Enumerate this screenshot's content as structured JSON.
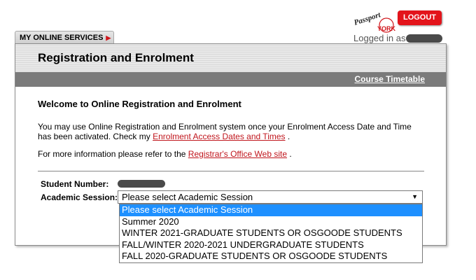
{
  "branding": {
    "logo_top": "Passport",
    "logo_bottom": "YORK",
    "logout_label": "LOGOUT",
    "logged_in_label": "Logged in as"
  },
  "nav": {
    "services_tab": "MY ONLINE SERVICES",
    "services_arrow": "▶"
  },
  "panel": {
    "title": "Registration and Enrolment",
    "timetable_link": "Course Timetable"
  },
  "content": {
    "welcome": "Welcome to Online Registration and Enrolment",
    "para1_text": "You may use Online Registration and Enrolment system once your Enrolment Access Date and Time has been activated. Check my",
    "para1_link": "Enrolment Access Dates and Times",
    "para1_end": ".",
    "para2_text": "For more information please refer to the",
    "para2_link": "Registrar's Office Web site",
    "para2_end": "."
  },
  "form": {
    "student_number_label": "Student Number:",
    "session_label": "Academic Session:",
    "session_selected": "Please select Academic Session",
    "session_options": [
      "Please select Academic Session",
      "Summer 2020",
      "WINTER 2021-GRADUATE STUDENTS OR OSGOODE STUDENTS",
      "FALL/WINTER 2020-2021 UNDERGRADUATE STUDENTS",
      "FALL 2020-GRADUATE STUDENTS OR OSGOODE STUDENTS"
    ]
  },
  "colors": {
    "accent_red": "#e3141b",
    "link_red": "#c0151c",
    "highlight_blue": "#1e90ff",
    "bar_gray": "#7b7b7b"
  },
  "icons": {
    "dropdown_caret": "▼"
  }
}
